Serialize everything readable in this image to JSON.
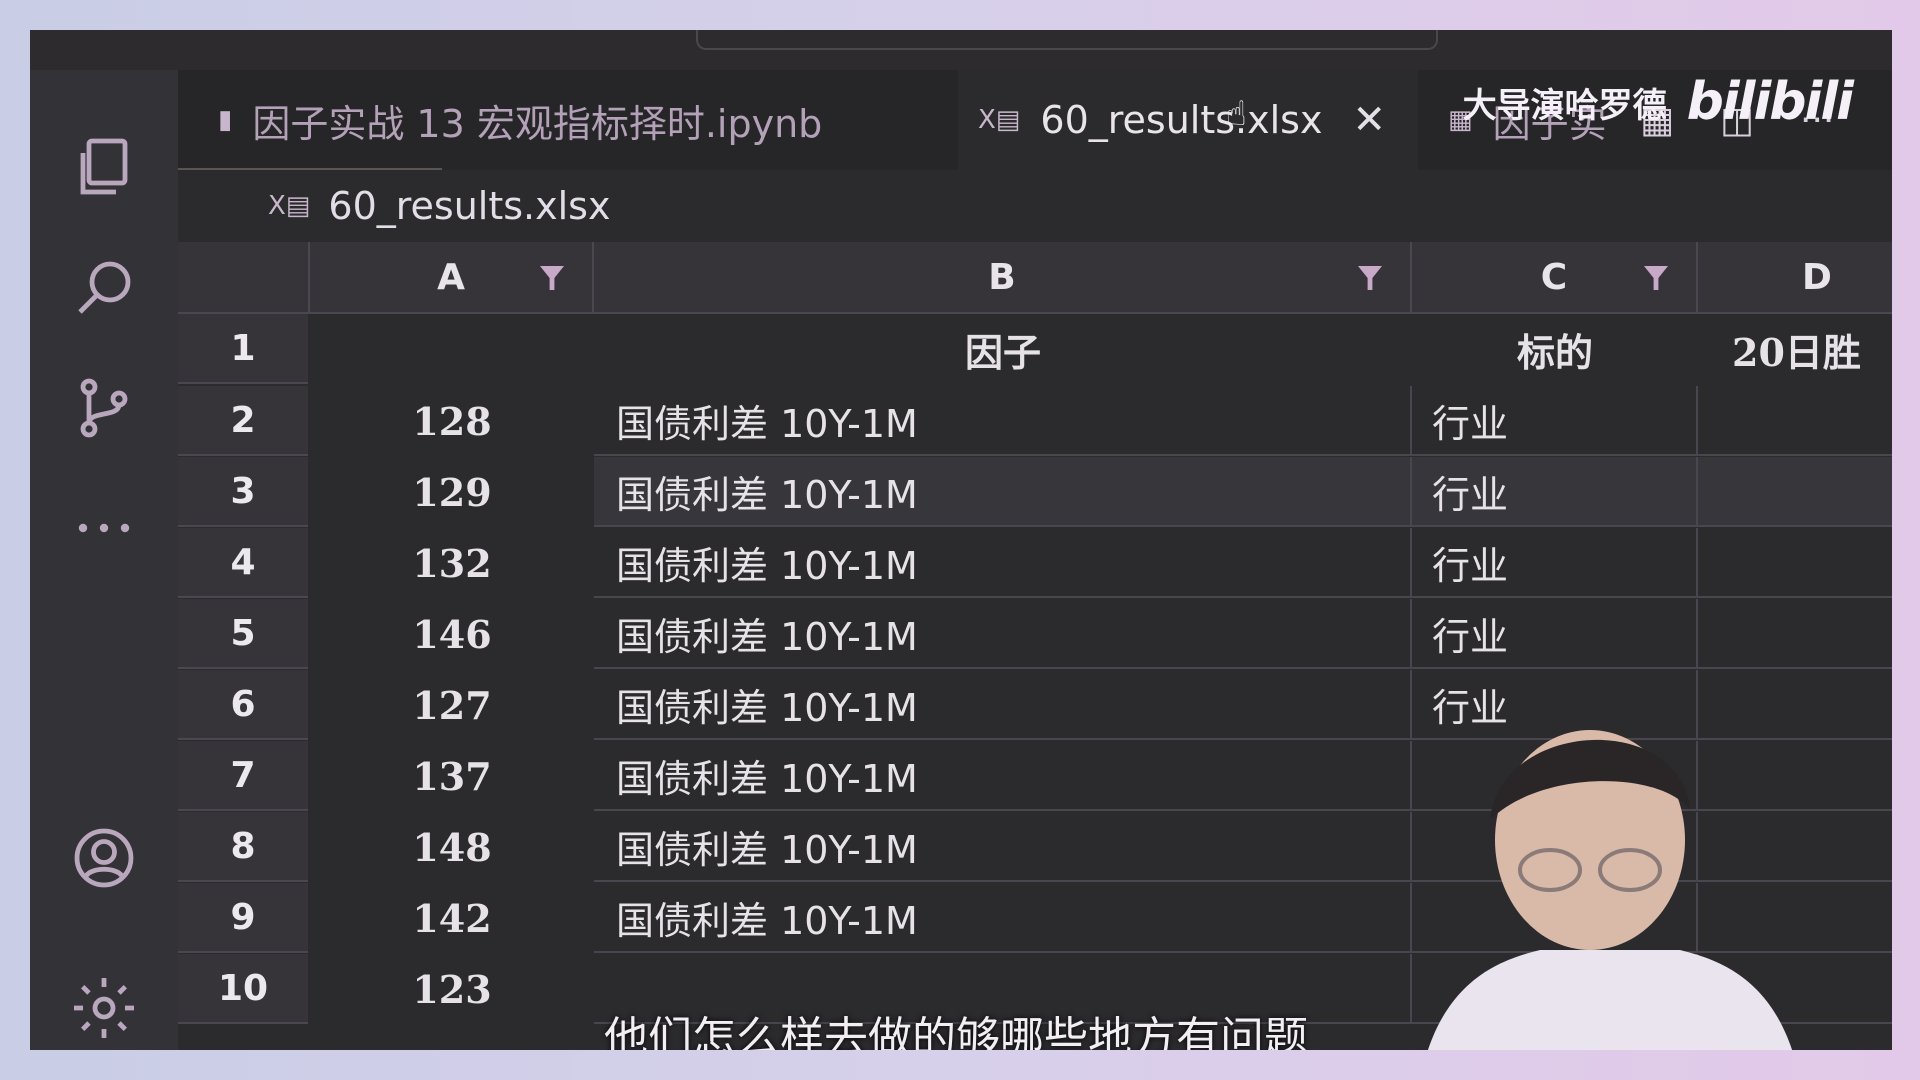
{
  "window": {
    "tabs": [
      {
        "label": "因子实战 13 宏观指标择时.ipynb",
        "icon": "notebook-icon",
        "active": false
      },
      {
        "label": "60_results.xlsx",
        "icon": "excel-icon",
        "active": true
      },
      {
        "label": "因子实",
        "icon": "table-preview-icon",
        "active": false
      }
    ]
  },
  "breadcrumb": {
    "file": "60_results.xlsx"
  },
  "sheet": {
    "columns": [
      "A",
      "B",
      "C",
      "D"
    ],
    "header_row": {
      "row": "1",
      "b": "因子",
      "c": "标的",
      "d": "20日胜"
    },
    "rows": [
      {
        "row": "2",
        "a": "128",
        "b": "国债利差 10Y-1M",
        "c": "行业"
      },
      {
        "row": "3",
        "a": "129",
        "b": "国债利差 10Y-1M",
        "c": "行业"
      },
      {
        "row": "4",
        "a": "132",
        "b": "国债利差 10Y-1M",
        "c": "行业"
      },
      {
        "row": "5",
        "a": "146",
        "b": "国债利差 10Y-1M",
        "c": "行业"
      },
      {
        "row": "6",
        "a": "127",
        "b": "国债利差 10Y-1M",
        "c": "行业"
      },
      {
        "row": "7",
        "a": "137",
        "b": "国债利差 10Y-1M",
        "c": ""
      },
      {
        "row": "8",
        "a": "148",
        "b": "国债利差 10Y-1M",
        "c": ""
      },
      {
        "row": "9",
        "a": "142",
        "b": "国债利差 10Y-1M",
        "c": ""
      },
      {
        "row": "10",
        "a": "123",
        "b": "",
        "c": ""
      }
    ]
  },
  "watermark": {
    "text": "大导演哈罗德",
    "logo": "bilibili"
  },
  "subtitle": "他们怎么样去做的够哪些地方有问题"
}
